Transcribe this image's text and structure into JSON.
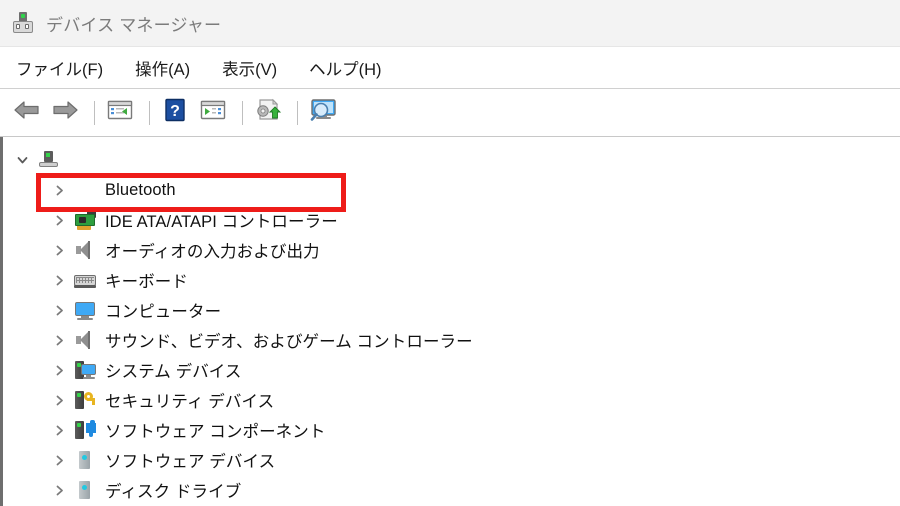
{
  "window": {
    "title": "デバイス マネージャー",
    "icon": "device-manager-icon"
  },
  "menubar": {
    "items": [
      {
        "label": "ファイル(F)",
        "name": "menu-file"
      },
      {
        "label": "操作(A)",
        "name": "menu-action"
      },
      {
        "label": "表示(V)",
        "name": "menu-view"
      },
      {
        "label": "ヘルプ(H)",
        "name": "menu-help"
      }
    ]
  },
  "toolbar": {
    "buttons": [
      {
        "name": "back-button",
        "icon": "back-arrow-icon"
      },
      {
        "name": "forward-button",
        "icon": "forward-arrow-icon"
      },
      {
        "name": "separator-1",
        "icon": "separator"
      },
      {
        "name": "hide-console-tree-button",
        "icon": "console-tree-icon"
      },
      {
        "name": "separator-2",
        "icon": "separator"
      },
      {
        "name": "help-button",
        "icon": "help-question-icon"
      },
      {
        "name": "properties-button",
        "icon": "properties-panel-icon"
      },
      {
        "name": "separator-3",
        "icon": "separator"
      },
      {
        "name": "update-driver-button",
        "icon": "update-driver-icon"
      },
      {
        "name": "separator-4",
        "icon": "separator"
      },
      {
        "name": "scan-hardware-changes-button",
        "icon": "scan-hardware-icon"
      }
    ]
  },
  "tree": {
    "root": {
      "label": "",
      "icon": "computer-root-icon",
      "expanded": true,
      "chevron": "chevron-down-icon"
    },
    "nodes": [
      {
        "label": "Bluetooth",
        "icon": "bluetooth-icon",
        "chevron": "chevron-right-icon",
        "highlighted": true
      },
      {
        "label": "IDE ATA/ATAPI コントローラー",
        "icon": "ide-controller-icon",
        "chevron": "chevron-right-icon",
        "highlighted": false
      },
      {
        "label": "オーディオの入力および出力",
        "icon": "speaker-icon",
        "chevron": "chevron-right-icon",
        "highlighted": false
      },
      {
        "label": "キーボード",
        "icon": "keyboard-icon",
        "chevron": "chevron-right-icon",
        "highlighted": false
      },
      {
        "label": "コンピューター",
        "icon": "monitor-icon",
        "chevron": "chevron-right-icon",
        "highlighted": false
      },
      {
        "label": "サウンド、ビデオ、およびゲーム コントローラー",
        "icon": "speaker-icon",
        "chevron": "chevron-right-icon",
        "highlighted": false
      },
      {
        "label": "システム デバイス",
        "icon": "system-device-icon",
        "chevron": "chevron-right-icon",
        "highlighted": false
      },
      {
        "label": "セキュリティ デバイス",
        "icon": "security-device-icon",
        "chevron": "chevron-right-icon",
        "highlighted": false
      },
      {
        "label": "ソフトウェア コンポーネント",
        "icon": "software-component-icon",
        "chevron": "chevron-right-icon",
        "highlighted": false
      },
      {
        "label": "ソフトウェア デバイス",
        "icon": "software-device-icon",
        "chevron": "chevron-right-icon",
        "highlighted": false
      },
      {
        "label": "ディスク ドライブ",
        "icon": "disk-drive-icon",
        "chevron": "chevron-right-icon",
        "highlighted": false
      }
    ]
  },
  "colors": {
    "highlight_border": "#ee1c19",
    "bluetooth_blue": "#1c8df0",
    "titlebar_bg": "#f3f3f3",
    "title_text": "#7b7b7b"
  }
}
